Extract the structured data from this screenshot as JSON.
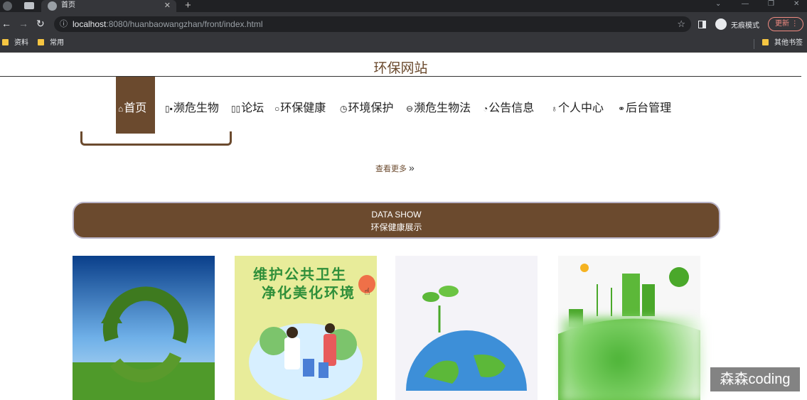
{
  "browser": {
    "tab_title": "首页",
    "url_host": "localhost",
    "url_rest": ":8080/huanbaowangzhan/front/index.html",
    "incognito_label": "无痕模式",
    "update_label": "更新",
    "bookmarks": [
      "资料",
      "常用"
    ],
    "other_bookmarks": "其他书签"
  },
  "site": {
    "title": "环保网站",
    "menu": [
      {
        "icon": "⌂",
        "label": "首页",
        "active": true
      },
      {
        "icon": "▯▪",
        "label": "濒危生物"
      },
      {
        "icon": "▯▯",
        "label": "论坛"
      },
      {
        "icon": "○",
        "label": "环保健康"
      },
      {
        "icon": "◷",
        "label": "环境保护"
      },
      {
        "icon": "⊖",
        "label": "濒危生物法"
      },
      {
        "icon": "◔",
        "label": "公告信息"
      },
      {
        "icon": "♁",
        "label": "个人中心"
      },
      {
        "icon": "⚭",
        "label": "后台管理"
      }
    ],
    "more_label": "查看更多",
    "banner": {
      "line1": "DATA SHOW",
      "line2": "环保健康展示"
    },
    "cards": [
      {
        "alt": "recycling-globe-grass"
      },
      {
        "alt": "poster",
        "headline1": "维护公共卫生",
        "headline2": "净化美化环境"
      },
      {
        "alt": "earth-sprout"
      },
      {
        "alt": "green-city"
      }
    ],
    "watermark": "森森coding"
  },
  "colors": {
    "brown": "#6b4a2e",
    "chrome_dark": "#202124",
    "chrome": "#35363a"
  }
}
